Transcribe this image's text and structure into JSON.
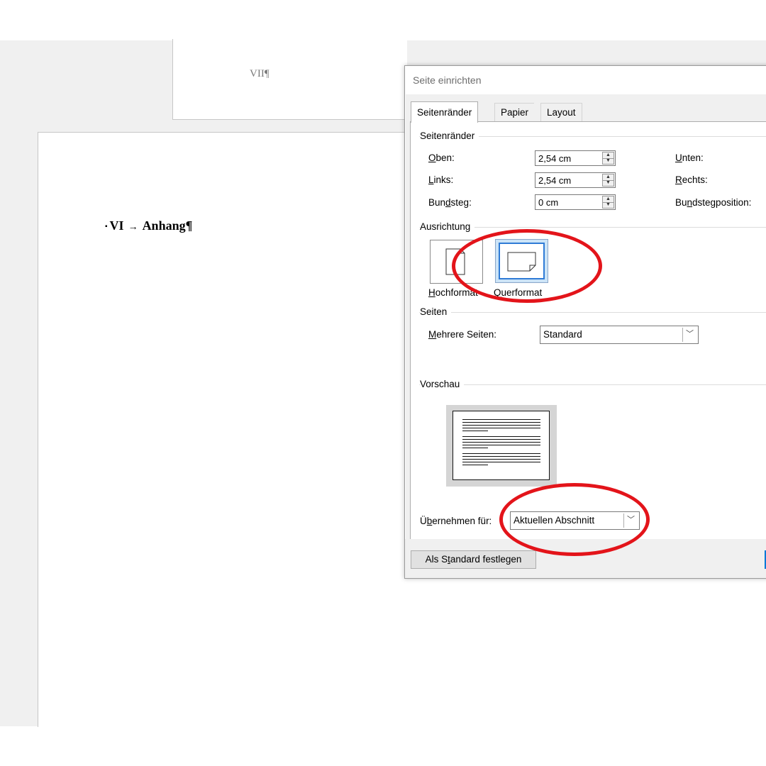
{
  "document": {
    "header_text": "VII¶",
    "heading_number": "VI",
    "heading_arrow": "→",
    "heading_text": "Anhang¶",
    "heading_marker": "▪"
  },
  "dialog": {
    "title": "Seite einrichten",
    "tabs": [
      {
        "label": "Seitenränder",
        "active": true
      },
      {
        "label": "Papier",
        "active": false
      },
      {
        "label": "Layout",
        "active": false
      }
    ],
    "margins_group": {
      "title": "Seitenränder",
      "oben": {
        "label_accel": "O",
        "label_rest": "ben:",
        "value": "2,54 cm"
      },
      "links": {
        "label_accel": "L",
        "label_rest": "inks:",
        "value": "2,54 cm"
      },
      "bundsteg": {
        "label_pre": "Bun",
        "label_accel": "d",
        "label_rest": "steg:",
        "value": "0 cm"
      },
      "unten": {
        "label_accel": "U",
        "label_rest": "nten:"
      },
      "rechts": {
        "label_accel": "R",
        "label_rest": "echts:"
      },
      "bundstegposition": {
        "label_pre": "Bu",
        "label_accel": "n",
        "label_rest": "dstegposition:"
      }
    },
    "orientation_group": {
      "title": "Ausrichtung",
      "hochformat": {
        "label_accel": "H",
        "label_rest": "ochformat"
      },
      "querformat": {
        "label_accel": "Q",
        "label_rest": "uerformat",
        "selected": true
      }
    },
    "pages_group": {
      "title": "Seiten",
      "mehrere_label_accel": "M",
      "mehrere_label_rest": "ehrere Seiten:",
      "mehrere_value": "Standard"
    },
    "preview_group": {
      "title": "Vorschau"
    },
    "apply_to": {
      "label_pre": "Ü",
      "label_accel": "b",
      "label_rest": "ernehmen für:",
      "value": "Aktuellen Abschnitt"
    },
    "set_default_button": {
      "label_pre": "Als S",
      "label_accel": "t",
      "label_rest": "andard festlegen"
    }
  },
  "colors": {
    "annotation_circle": "#e3141a",
    "selection_blue": "#2f7bd6",
    "primary_button": "#0078d7"
  }
}
